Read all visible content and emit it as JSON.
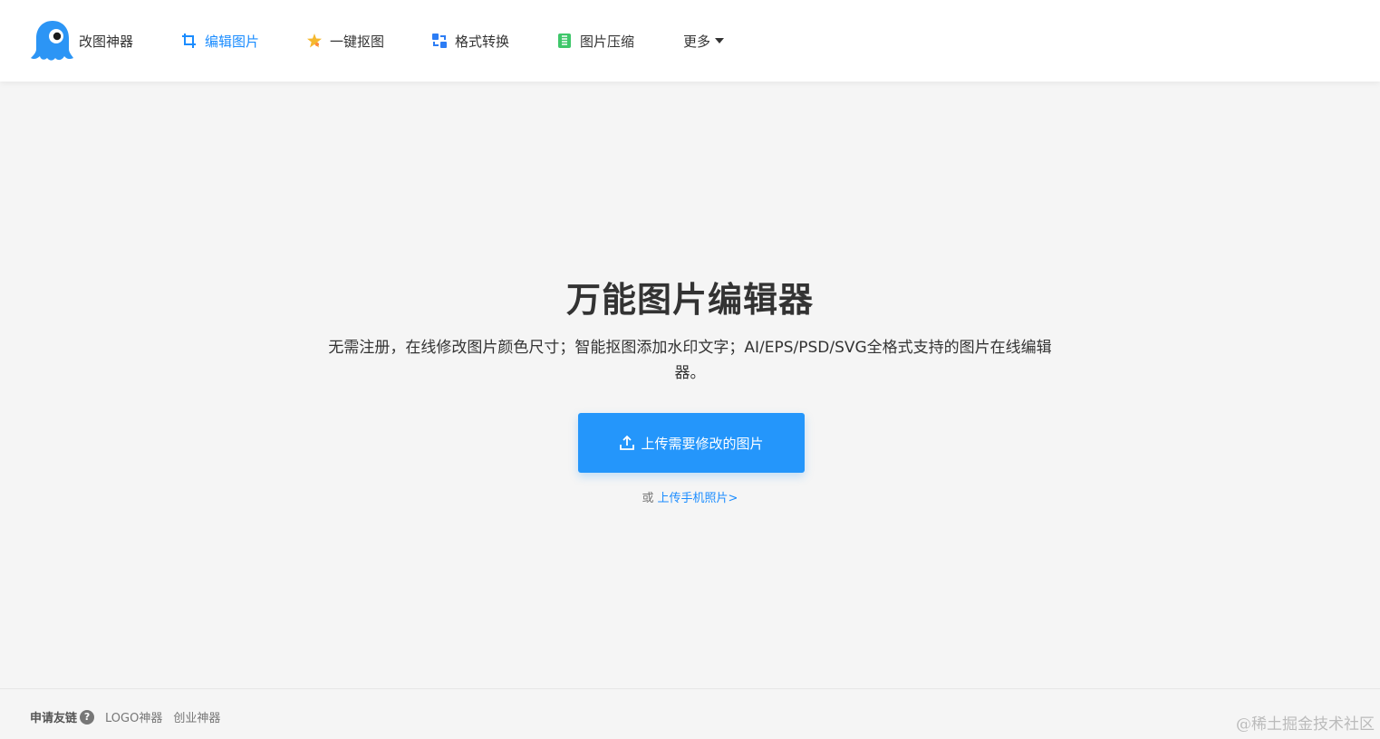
{
  "header": {
    "brand": {
      "name": "改图神器",
      "logo_icon": "ghost-mascot-logo",
      "color": "#1a8cff"
    },
    "nav": [
      {
        "label": "编辑图片",
        "icon": "crop-icon",
        "active": true
      },
      {
        "label": "一键抠图",
        "icon": "star-magic-icon",
        "active": false
      },
      {
        "label": "格式转换",
        "icon": "convert-icon",
        "active": false
      },
      {
        "label": "图片压缩",
        "icon": "compress-icon",
        "active": false
      }
    ],
    "more_label": "更多"
  },
  "hero": {
    "title": "万能图片编辑器",
    "description": "无需注册，在线修改图片颜色尺寸；智能抠图添加水印文字；AI/EPS/PSD/SVG全格式支持的图片在线编辑器。",
    "upload_button": "上传需要修改的图片",
    "alt_prefix": "或",
    "alt_link": "上传手机照片>"
  },
  "footer": {
    "friend_link_label": "申请友链",
    "help_icon": "?",
    "links": [
      "LOGO神器",
      "创业神器"
    ]
  },
  "watermark": "@稀土掘金技术社区",
  "colors": {
    "accent": "#1a8cff",
    "button": "#2496fb",
    "background": "#f5f5f5"
  }
}
